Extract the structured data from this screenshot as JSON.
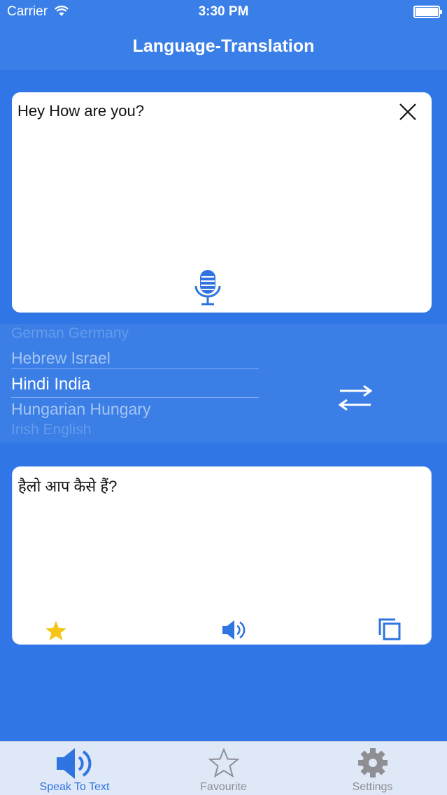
{
  "status_bar": {
    "carrier": "Carrier",
    "time": "3:30 PM"
  },
  "nav": {
    "title": "Language-Translation"
  },
  "input": {
    "text": "Hey How are you?"
  },
  "picker": {
    "rows": [
      "German Germany",
      "Hebrew Israel",
      "Hindi India",
      "Hungarian Hungary",
      "Irish English"
    ],
    "selected": "Hindi India"
  },
  "output": {
    "text": "हैलो आप कैसे हैं?"
  },
  "tabs": [
    {
      "label": "Speak To Text",
      "icon": "speaker-icon",
      "active": true
    },
    {
      "label": "Favourite",
      "icon": "star-outline-icon",
      "active": false
    },
    {
      "label": "Settings",
      "icon": "gear-icon",
      "active": false
    }
  ],
  "colors": {
    "background": "#3176e6",
    "accent": "#2f74e0",
    "star": "#f5c518",
    "tab_inactive": "#8e8e93"
  }
}
